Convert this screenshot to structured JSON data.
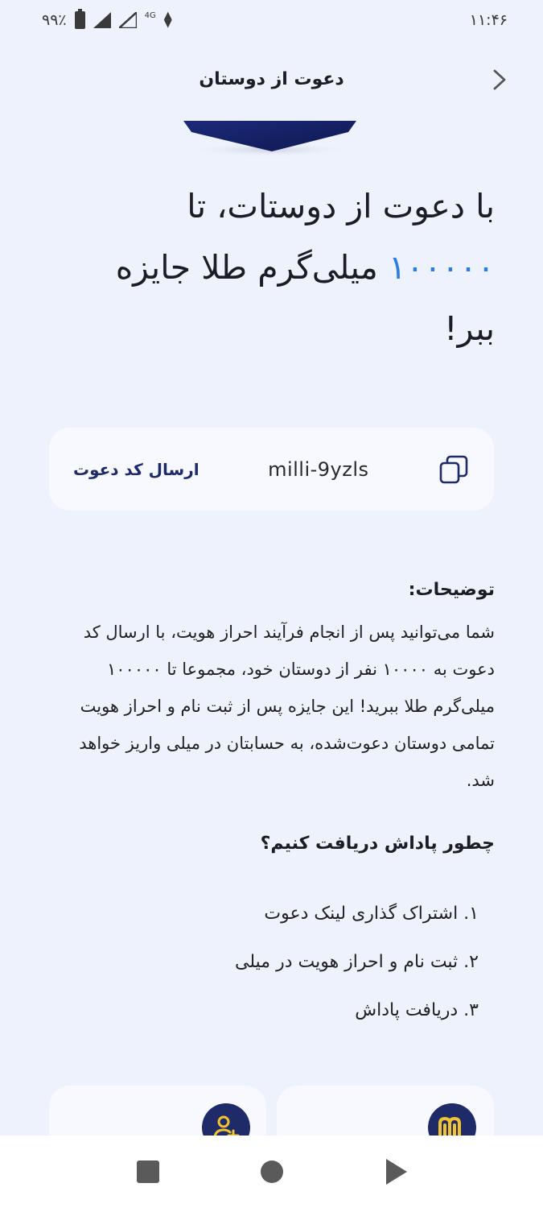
{
  "status_bar": {
    "battery": "۹۹٪",
    "network": "4G",
    "time": "۱۱:۴۶"
  },
  "header": {
    "title": "دعوت از دوستان"
  },
  "hero": {
    "line1": "با دعوت از دوستات، تا",
    "amount": "۱۰۰۰۰۰",
    "line2_rest": " میلی‌گرم طلا جایزه",
    "line3": "ببر!"
  },
  "invite": {
    "send_label": "ارسال کد دعوت",
    "code": "milli-9yzls"
  },
  "description": {
    "title": "توضیحات:",
    "text": "شما می‌توانید پس از انجام فرآیند احراز هویت، با ارسال کد دعوت به ۱۰۰۰۰ نفر از دوستان خود، مجموعا تا ۱۰۰۰۰۰ میلی‌گرم طلا ببرید! این جایزه پس از ثبت نام و احراز هویت تمامی دوستان دعوت‌شده، به حسابتان در میلی واریز خواهد شد."
  },
  "how": {
    "title": "چطور پاداش دریافت کنیم؟",
    "steps": [
      "۱. اشتراک گذاری لینک دعوت",
      "۲. ثبت نام و احراز هویت در میلی",
      "۳. دریافت پاداش"
    ]
  },
  "colors": {
    "accent": "#2e7de0",
    "brand_navy": "#1f2a68",
    "gold": "#f2c230",
    "background": "#eef2fc"
  }
}
